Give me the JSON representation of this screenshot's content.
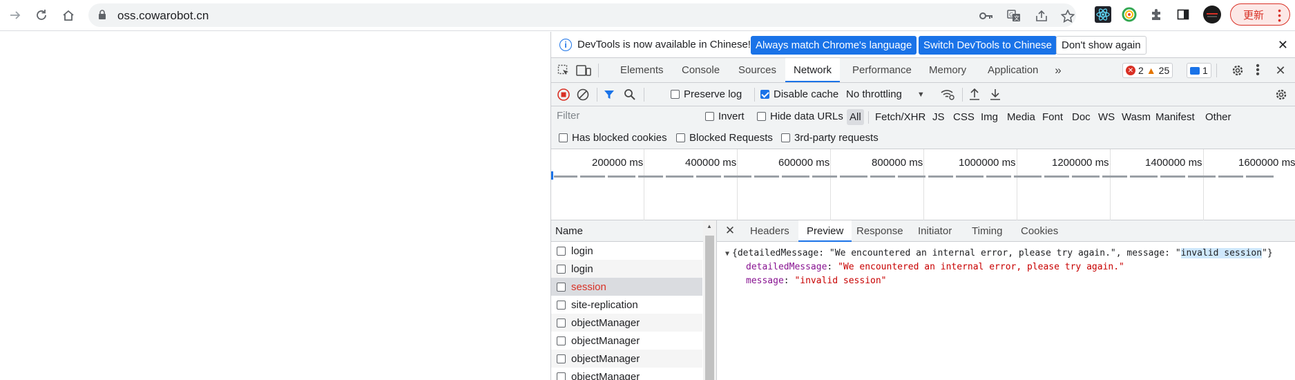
{
  "browser": {
    "url": "oss.cowarobot.cn",
    "update_label": "更新"
  },
  "infobar": {
    "message": "DevTools is now available in Chinese!",
    "btn_match": "Always match Chrome's language",
    "btn_switch": "Switch DevTools to Chinese",
    "btn_dismiss": "Don't show again"
  },
  "devtools_tabs": [
    "Elements",
    "Console",
    "Sources",
    "Network",
    "Performance",
    "Memory",
    "Application"
  ],
  "active_tab": "Network",
  "badges": {
    "errors": "2",
    "warnings": "25",
    "messages": "1"
  },
  "network_toolbar": {
    "preserve_log": "Preserve log",
    "disable_cache": "Disable cache",
    "throttling": "No throttling"
  },
  "filter": {
    "placeholder": "Filter",
    "invert": "Invert",
    "hide_data_urls": "Hide data URLs",
    "types": [
      "All",
      "Fetch/XHR",
      "JS",
      "CSS",
      "Img",
      "Media",
      "Font",
      "Doc",
      "WS",
      "Wasm",
      "Manifest",
      "Other"
    ],
    "has_blocked_cookies": "Has blocked cookies",
    "blocked_requests": "Blocked Requests",
    "third_party": "3rd-party requests"
  },
  "timeline_ticks": [
    "200000 ms",
    "400000 ms",
    "600000 ms",
    "800000 ms",
    "1000000 ms",
    "1200000 ms",
    "1400000 ms",
    "1600000 ms"
  ],
  "request_list": {
    "header": "Name",
    "rows": [
      "login",
      "login",
      "session",
      "site-replication",
      "objectManager",
      "objectManager",
      "objectManager",
      "objectManager"
    ]
  },
  "detail_tabs": [
    "Headers",
    "Preview",
    "Response",
    "Initiator",
    "Timing",
    "Cookies"
  ],
  "active_detail_tab": "Preview",
  "preview": {
    "summary_prefix": "{detailedMessage: \"We encountered an internal error, please try again.\", message: \"",
    "summary_highlight": "invalid session",
    "summary_suffix": "\"}",
    "key1": "detailedMessage",
    "val1": "\"We encountered an internal error, please try again.\"",
    "key2": "message",
    "val2": "\"invalid session\"",
    "colon": ": "
  }
}
